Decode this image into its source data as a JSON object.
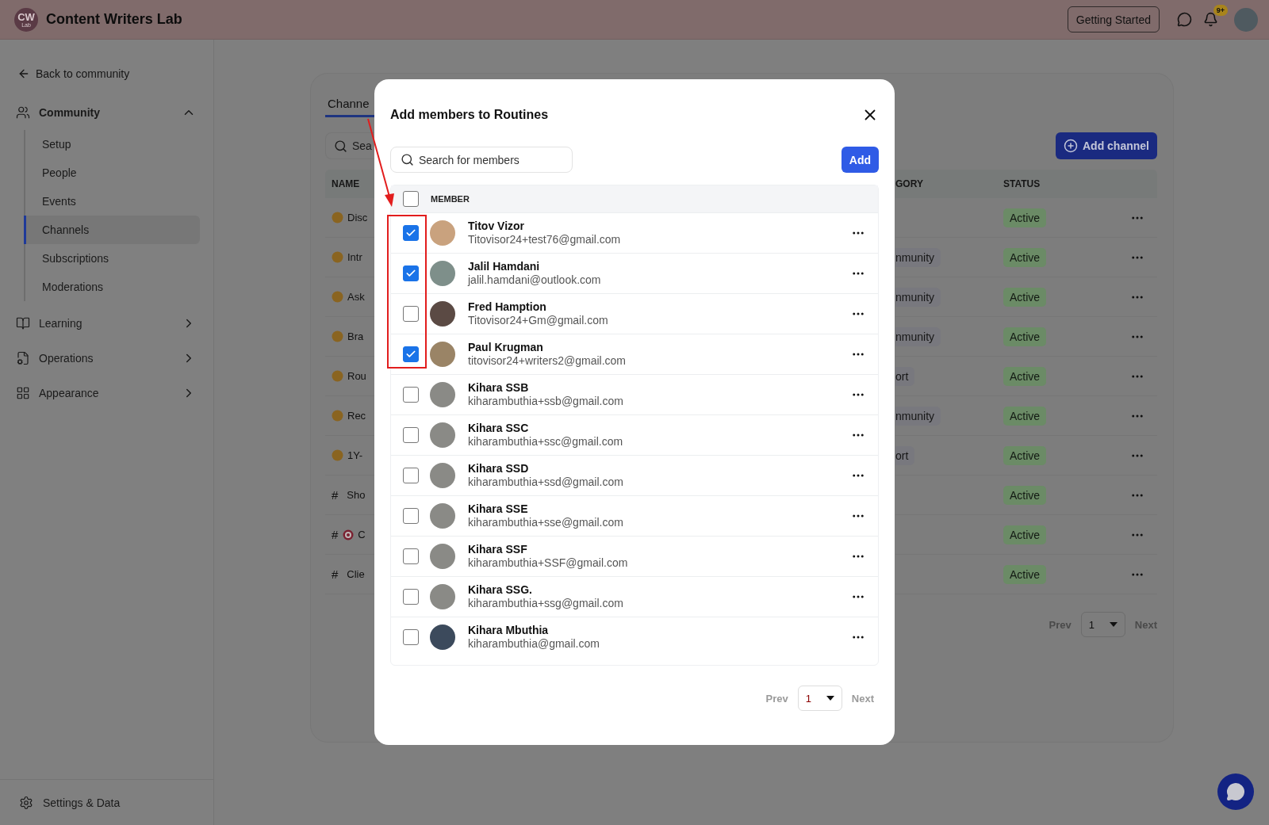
{
  "header": {
    "logo_initials": "CW",
    "logo_sub": "Lab",
    "title": "Content Writers Lab",
    "getting_started": "Getting Started",
    "notification_badge": "9+"
  },
  "sidebar": {
    "back_link": "Back to community",
    "sections": [
      {
        "label": "Community",
        "expanded": true,
        "children": [
          {
            "label": "Setup",
            "selected": false
          },
          {
            "label": "People",
            "selected": false
          },
          {
            "label": "Events",
            "selected": false
          },
          {
            "label": "Channels",
            "selected": true
          },
          {
            "label": "Subscriptions",
            "selected": false
          },
          {
            "label": "Moderations",
            "selected": false
          }
        ]
      },
      {
        "label": "Learning",
        "expanded": false
      },
      {
        "label": "Operations",
        "expanded": false
      },
      {
        "label": "Appearance",
        "expanded": false
      }
    ],
    "footer": "Settings & Data"
  },
  "channels_panel": {
    "tabs": [
      {
        "label": "Channe",
        "selected": true
      }
    ],
    "search_placeholder": "Sea",
    "add_button": "Add channel",
    "columns": {
      "name": "NAME",
      "category": "GORY",
      "status": "STATUS"
    },
    "rows": [
      {
        "kind": "emoji",
        "name": "Disc",
        "status": "Active"
      },
      {
        "kind": "emoji",
        "name": "Intr",
        "category": "nmunity",
        "status": "Active"
      },
      {
        "kind": "emoji",
        "name": "Ask",
        "category": "nmunity",
        "status": "Active"
      },
      {
        "kind": "emoji",
        "name": "Bra",
        "category": "nmunity",
        "status": "Active"
      },
      {
        "kind": "emoji",
        "name": "Rou",
        "category": "ort",
        "status": "Active"
      },
      {
        "kind": "emoji",
        "name": "Rec",
        "category": "nmunity",
        "status": "Active"
      },
      {
        "kind": "emoji",
        "name": "1Y-",
        "category": "ort",
        "status": "Active"
      },
      {
        "kind": "hash",
        "prefix": "#",
        "name": "Sho",
        "status": "Active"
      },
      {
        "kind": "hash_emoji",
        "prefix": "#",
        "name": "C",
        "status": "Active"
      },
      {
        "kind": "hash",
        "prefix": "#",
        "name": "Clie",
        "status": "Active"
      }
    ],
    "pagination": {
      "prev": "Prev",
      "page": "1",
      "next": "Next"
    }
  },
  "modal": {
    "title": "Add members to Routines",
    "search_placeholder": "Search for members",
    "add_button": "Add",
    "column": "MEMBER",
    "select_all_checked": false,
    "members": [
      {
        "name": "Titov Vizor",
        "email": "Titovisor24+test76@gmail.com",
        "checked": true
      },
      {
        "name": "Jalil Hamdani",
        "email": "jalil.hamdani@outlook.com",
        "checked": true
      },
      {
        "name": "Fred Hamption",
        "email": "Titovisor24+Gm@gmail.com",
        "checked": false
      },
      {
        "name": "Paul Krugman",
        "email": "titovisor24+writers2@gmail.com",
        "checked": true
      },
      {
        "name": "Kihara SSB",
        "email": "kiharambuthia+ssb@gmail.com",
        "checked": false
      },
      {
        "name": "Kihara SSC",
        "email": "kiharambuthia+ssc@gmail.com",
        "checked": false
      },
      {
        "name": "Kihara SSD",
        "email": "kiharambuthia+ssd@gmail.com",
        "checked": false
      },
      {
        "name": "Kihara SSE",
        "email": "kiharambuthia+sse@gmail.com",
        "checked": false
      },
      {
        "name": "Kihara SSF",
        "email": "kiharambuthia+SSF@gmail.com",
        "checked": false
      },
      {
        "name": "Kihara SSG.",
        "email": "kiharambuthia+ssg@gmail.com",
        "checked": false
      },
      {
        "name": "Kihara Mbuthia",
        "email": "kiharambuthia@gmail.com",
        "checked": false
      }
    ],
    "pagination": {
      "prev": "Prev",
      "page": "1",
      "next": "Next"
    }
  }
}
